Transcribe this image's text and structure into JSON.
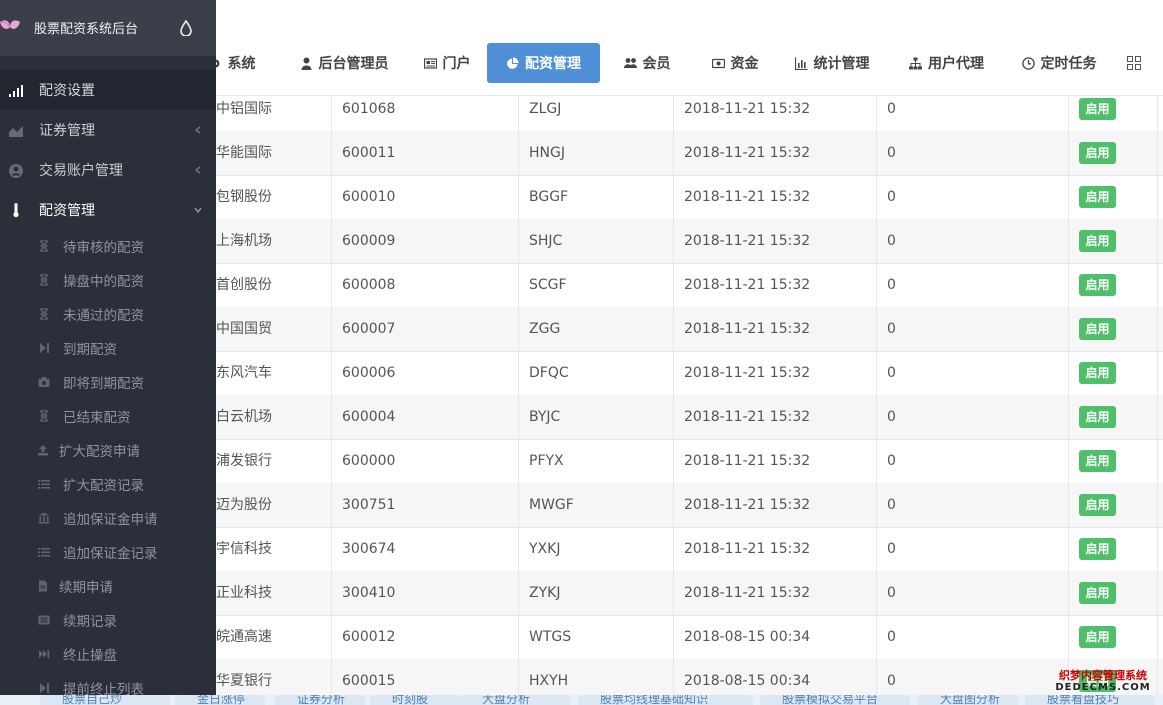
{
  "brand": {
    "title": "股票配资系统后台"
  },
  "sidebar": {
    "items": [
      {
        "label": "配资设置",
        "icon": "signal-icon",
        "active": true
      },
      {
        "label": "证券管理",
        "icon": "area-chart-icon"
      },
      {
        "label": "交易账户管理",
        "icon": "user-circle-icon"
      },
      {
        "label": "配资管理",
        "icon": "thermometer-icon",
        "expanded": true
      }
    ],
    "subitems": [
      {
        "label": "待审核的配资",
        "icon": "hourglass-icon"
      },
      {
        "label": "操盘中的配资",
        "icon": "hourglass-icon"
      },
      {
        "label": "未通过的配资",
        "icon": "hourglass-icon"
      },
      {
        "label": "到期配资",
        "icon": "step-forward-icon"
      },
      {
        "label": "即将到期配资",
        "icon": "camera-icon"
      },
      {
        "label": "已结束配资",
        "icon": "hourglass-icon"
      },
      {
        "label": "扩大配资申请",
        "icon": "upload-icon"
      },
      {
        "label": "扩大配资记录",
        "icon": "list-icon"
      },
      {
        "label": "追加保证金申请",
        "icon": "bank-icon"
      },
      {
        "label": "追加保证金记录",
        "icon": "list-icon"
      },
      {
        "label": "续期申请",
        "icon": "file-icon"
      },
      {
        "label": "续期记录",
        "icon": "list-alt-icon"
      },
      {
        "label": "终止操盘",
        "icon": "fast-forward-icon"
      },
      {
        "label": "提前终止列表",
        "icon": "step-forward-icon"
      }
    ]
  },
  "topnav": {
    "tabs": [
      {
        "label": "系统",
        "icon": "gear-icon"
      },
      {
        "label": "后台管理员",
        "icon": "user-icon"
      },
      {
        "label": "门户",
        "icon": "newspaper-icon"
      },
      {
        "label": "配资管理",
        "icon": "pie-chart-icon",
        "active": true
      },
      {
        "label": "会员",
        "icon": "users-icon"
      },
      {
        "label": "资金",
        "icon": "money-icon"
      },
      {
        "label": "统计管理",
        "icon": "bar-chart-icon"
      },
      {
        "label": "用户代理",
        "icon": "sitemap-icon"
      },
      {
        "label": "定时任务",
        "icon": "clock-icon"
      }
    ],
    "more_icon": "grid-icon"
  },
  "table": {
    "rows": [
      {
        "name": "中铝国际",
        "code": "601068",
        "abbr": "ZLGJ",
        "time": "2018-11-21 15:32",
        "num": "0",
        "status": "启用"
      },
      {
        "name": "华能国际",
        "code": "600011",
        "abbr": "HNGJ",
        "time": "2018-11-21 15:32",
        "num": "0",
        "status": "启用"
      },
      {
        "name": "包钢股份",
        "code": "600010",
        "abbr": "BGGF",
        "time": "2018-11-21 15:32",
        "num": "0",
        "status": "启用"
      },
      {
        "name": "上海机场",
        "code": "600009",
        "abbr": "SHJC",
        "time": "2018-11-21 15:32",
        "num": "0",
        "status": "启用"
      },
      {
        "name": "首创股份",
        "code": "600008",
        "abbr": "SCGF",
        "time": "2018-11-21 15:32",
        "num": "0",
        "status": "启用"
      },
      {
        "name": "中国国贸",
        "code": "600007",
        "abbr": "ZGG",
        "time": "2018-11-21 15:32",
        "num": "0",
        "status": "启用"
      },
      {
        "name": "东风汽车",
        "code": "600006",
        "abbr": "DFQC",
        "time": "2018-11-21 15:32",
        "num": "0",
        "status": "启用"
      },
      {
        "name": "白云机场",
        "code": "600004",
        "abbr": "BYJC",
        "time": "2018-11-21 15:32",
        "num": "0",
        "status": "启用"
      },
      {
        "name": "浦发银行",
        "code": "600000",
        "abbr": "PFYX",
        "time": "2018-11-21 15:32",
        "num": "0",
        "status": "启用"
      },
      {
        "name": "迈为股份",
        "code": "300751",
        "abbr": "MWGF",
        "time": "2018-11-21 15:32",
        "num": "0",
        "status": "启用"
      },
      {
        "name": "宇信科技",
        "code": "300674",
        "abbr": "YXKJ",
        "time": "2018-11-21 15:32",
        "num": "0",
        "status": "启用"
      },
      {
        "name": "正业科技",
        "code": "300410",
        "abbr": "ZYKJ",
        "time": "2018-11-21 15:32",
        "num": "0",
        "status": "启用"
      },
      {
        "name": "皖通高速",
        "code": "600012",
        "abbr": "WTGS",
        "time": "2018-08-15 00:34",
        "num": "0",
        "status": "启用"
      },
      {
        "name": "华夏银行",
        "code": "600015",
        "abbr": "HXYH",
        "time": "2018-08-15 00:34",
        "num": "0",
        "status": "启用"
      }
    ]
  },
  "bottom_tabs": [
    {
      "label": "股票自己炒"
    },
    {
      "label": "金日涨停"
    },
    {
      "label": "证券分析"
    },
    {
      "label": "时刻股"
    },
    {
      "label": "大盘分析"
    },
    {
      "label": "股票均线理基础知识"
    },
    {
      "label": "股票模拟交易平台"
    },
    {
      "label": "大盘图分析"
    },
    {
      "label": "股票看盘技巧"
    }
  ],
  "watermark": {
    "line1": "织梦内容管理系统",
    "line2": "DEDECMS.COM"
  }
}
